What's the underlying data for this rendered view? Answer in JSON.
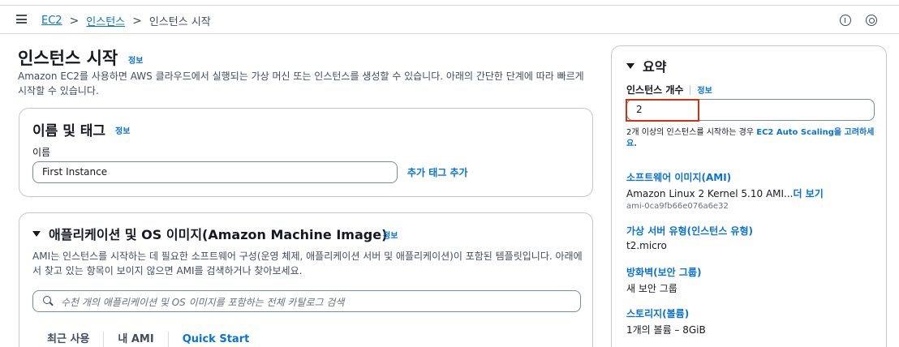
{
  "breadcrumb": {
    "items": [
      "EC2",
      "인스턴스"
    ],
    "current": "인스턴스 시작",
    "separator": ">"
  },
  "header_icons": [
    "hamburger-menu-icon",
    "info-icon",
    "settings-icon"
  ],
  "page": {
    "title": "인스턴스 시작",
    "info_link": "정보",
    "description": "Amazon EC2를 사용하면 AWS 클라우드에서 실행되는 가상 머신 또는 인스턴스를 생성할 수 있습니다. 아래의 간단한 단계에 따라 빠르게 시작할 수 있습니다."
  },
  "name_tags": {
    "title": "이름 및 태그",
    "info_link": "정보",
    "name_label": "이름",
    "name_value": "First Instance",
    "add_tag_link": "추가 태그 추가"
  },
  "ami_section": {
    "title": "애플리케이션 및 OS 이미지(Amazon Machine Image)",
    "info_link": "정보",
    "description": "AMI는 인스턴스를 시작하는 데 필요한 소프트웨어 구성(운영 체제, 애플리케이션 서버 및 애플리케이션)이 포함된 템플릿입니다. 아래에서 찾고 있는 항목이 보이지 않으면 AMI를 검색하거나 찾아보세요.",
    "search_placeholder": "수천 개의 애플리케이션 및 OS 이미지를 포함하는 전체 카탈로그 검색",
    "tabs": [
      "최근 사용",
      "내 AMI",
      "Quick Start"
    ]
  },
  "summary": {
    "title": "요약",
    "count_label": "인스턴스 개수",
    "count_info": "정보",
    "count_value": "2",
    "hint_text": "2개 이상의 인스턴스를 시작하는 경우 ",
    "hint_link": "EC2 Auto Scaling을 고려하세요.",
    "software_image_label": "소프트웨어 이미지(AMI)",
    "software_image_value": "Amazon Linux 2 Kernel 5.10 AMI...",
    "software_image_more": "더 보기",
    "software_image_id": "ami-0ca9fb66e076a6e32",
    "server_type_label": "가상 서버 유형(인스턴스 유형)",
    "server_type_value": "t2.micro",
    "firewall_label": "방화벽(보안 그룹)",
    "firewall_value": "새 보안 그룹",
    "storage_label": "스토리지(볼륨)",
    "storage_value": "1개의 볼륨 – 8GiB"
  },
  "colors": {
    "link": "#0972d3",
    "text": "#16191f",
    "muted": "#414d5c",
    "highlight": "#d13212",
    "border": "#c6c6cd"
  }
}
